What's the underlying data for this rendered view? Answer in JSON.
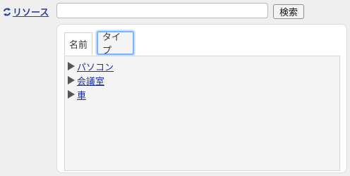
{
  "header": {
    "resource_label": "リソース",
    "search_value": "",
    "search_placeholder": "",
    "search_button_label": "検索"
  },
  "tabs": [
    {
      "label": "名前"
    },
    {
      "label": "タイプ"
    }
  ],
  "tree": {
    "items": [
      {
        "label": "パソコン"
      },
      {
        "label": "会議室"
      },
      {
        "label": "車"
      }
    ]
  },
  "colors": {
    "link": "#1a2fa6",
    "focus_ring": "#7ab3ff",
    "background": "#efefef"
  }
}
